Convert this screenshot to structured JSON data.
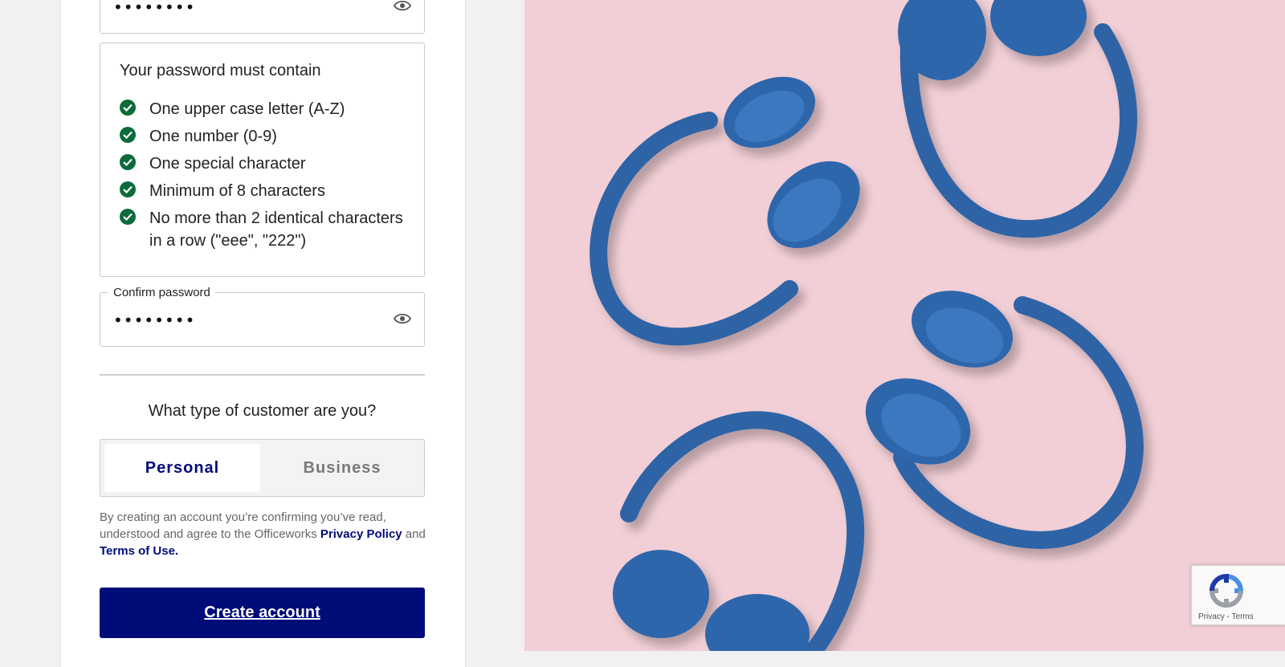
{
  "password_field": {
    "value": "••••••••"
  },
  "requirements": {
    "heading": "Your password must contain",
    "items": [
      "One upper case letter (A-Z)",
      "One number (0-9)",
      "One special character",
      "Minimum of 8 characters",
      "No more than 2 identical characters in a row (\"eee\", \"222\")"
    ]
  },
  "confirm_field": {
    "label": "Confirm password",
    "value": "••••••••"
  },
  "customer_type": {
    "question": "What type of customer are you?",
    "options": [
      "Personal",
      "Business"
    ],
    "selected": "Personal"
  },
  "legal": {
    "prefix": "By creating an account you’re confirming you’ve read, understood and agree to the Officeworks ",
    "privacy_link": "Privacy Policy",
    "middle": " and ",
    "terms_link": "Terms of Use."
  },
  "create_button": "Create account",
  "recaptcha": {
    "privacy": "Privacy",
    "separator": " - ",
    "terms": "Terms"
  },
  "colors": {
    "brand": "#000c78",
    "check": "#0b6b3a",
    "hero_bg": "#f2cfd6",
    "headphone": "#2e64a6"
  }
}
